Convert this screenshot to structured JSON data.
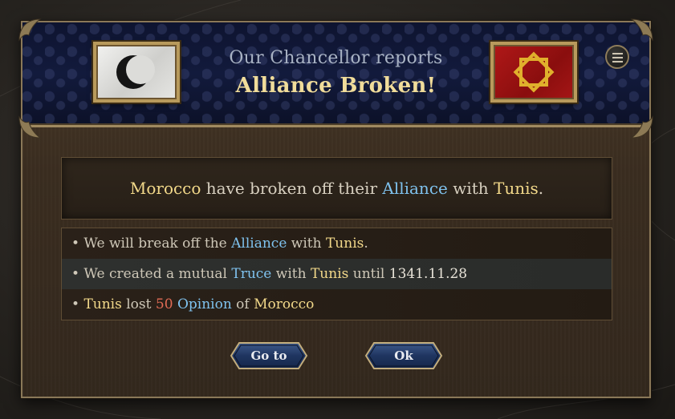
{
  "header": {
    "subtitle": "Our Chancellor reports",
    "title": "Alliance Broken!"
  },
  "flags": {
    "left": {
      "icon": "crescent-icon",
      "color": "#ececea"
    },
    "right": {
      "icon": "octagram-star-icon",
      "color": "#a51616"
    }
  },
  "message": {
    "actor": "Morocco",
    "text1": " have broken off their ",
    "relation": "Alliance",
    "text2": " with ",
    "target": "Tunis",
    "end": "."
  },
  "effects": [
    {
      "bullet": "•",
      "t1": " We will break off the ",
      "k1": "Alliance",
      "t2": " with ",
      "k2": "Tunis",
      "t3": "."
    },
    {
      "bullet": "•",
      "t1": " We created a mutual ",
      "k1": "Truce",
      "t2": " with ",
      "k2": "Tunis",
      "t3": " until ",
      "date": "1341.11.28"
    },
    {
      "bullet": "•",
      "t0": " ",
      "k0": "Tunis",
      "t1": " lost ",
      "num": "50",
      "t2": " ",
      "k1": "Opinion",
      "t3": " of ",
      "k2": "Morocco"
    }
  ],
  "buttons": {
    "goto": "Go to",
    "ok": "Ok"
  },
  "colors": {
    "gold": "#f3d98a",
    "blue": "#7fc2ee",
    "red": "#e26b55",
    "header_bg": "#121a3c"
  },
  "icons": {
    "menu": "hamburger-menu-icon"
  }
}
